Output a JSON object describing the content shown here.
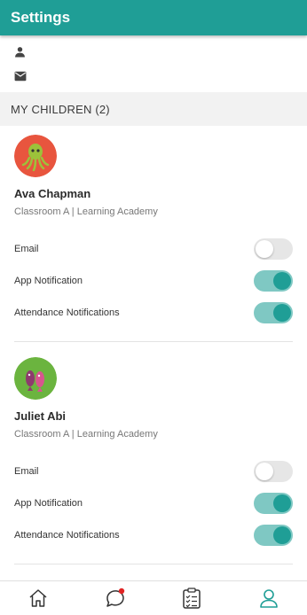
{
  "header": {
    "title": "Settings"
  },
  "profile": {
    "name_value": "",
    "email_value": ""
  },
  "section": {
    "title": "MY CHILDREN (2)"
  },
  "children": [
    {
      "name": "Ava Chapman",
      "school": "Classroom A | Learning Academy",
      "avatar_icon": "octopus-icon",
      "avatar_color": "#e8553e",
      "prefs": [
        {
          "label": "Email",
          "on": false
        },
        {
          "label": "App Notification",
          "on": true
        },
        {
          "label": "Attendance Notifications",
          "on": true
        }
      ]
    },
    {
      "name": "Juliet Abi",
      "school": "Classroom A | Learning Academy",
      "avatar_icon": "fish-icon",
      "avatar_color": "#6bb43f",
      "prefs": [
        {
          "label": "Email",
          "on": false
        },
        {
          "label": "App Notification",
          "on": true
        },
        {
          "label": "Attendance Notifications",
          "on": true
        }
      ]
    }
  ],
  "bottom_nav": {
    "items": [
      "home-icon",
      "chat-icon",
      "clipboard-icon",
      "profile-icon"
    ],
    "active": "profile-icon",
    "chat_badge_color": "#e02424"
  },
  "colors": {
    "primary": "#1f9e96",
    "toggle_track_on": "#7fc8c3",
    "toggle_track_off": "#e6e6e6"
  }
}
